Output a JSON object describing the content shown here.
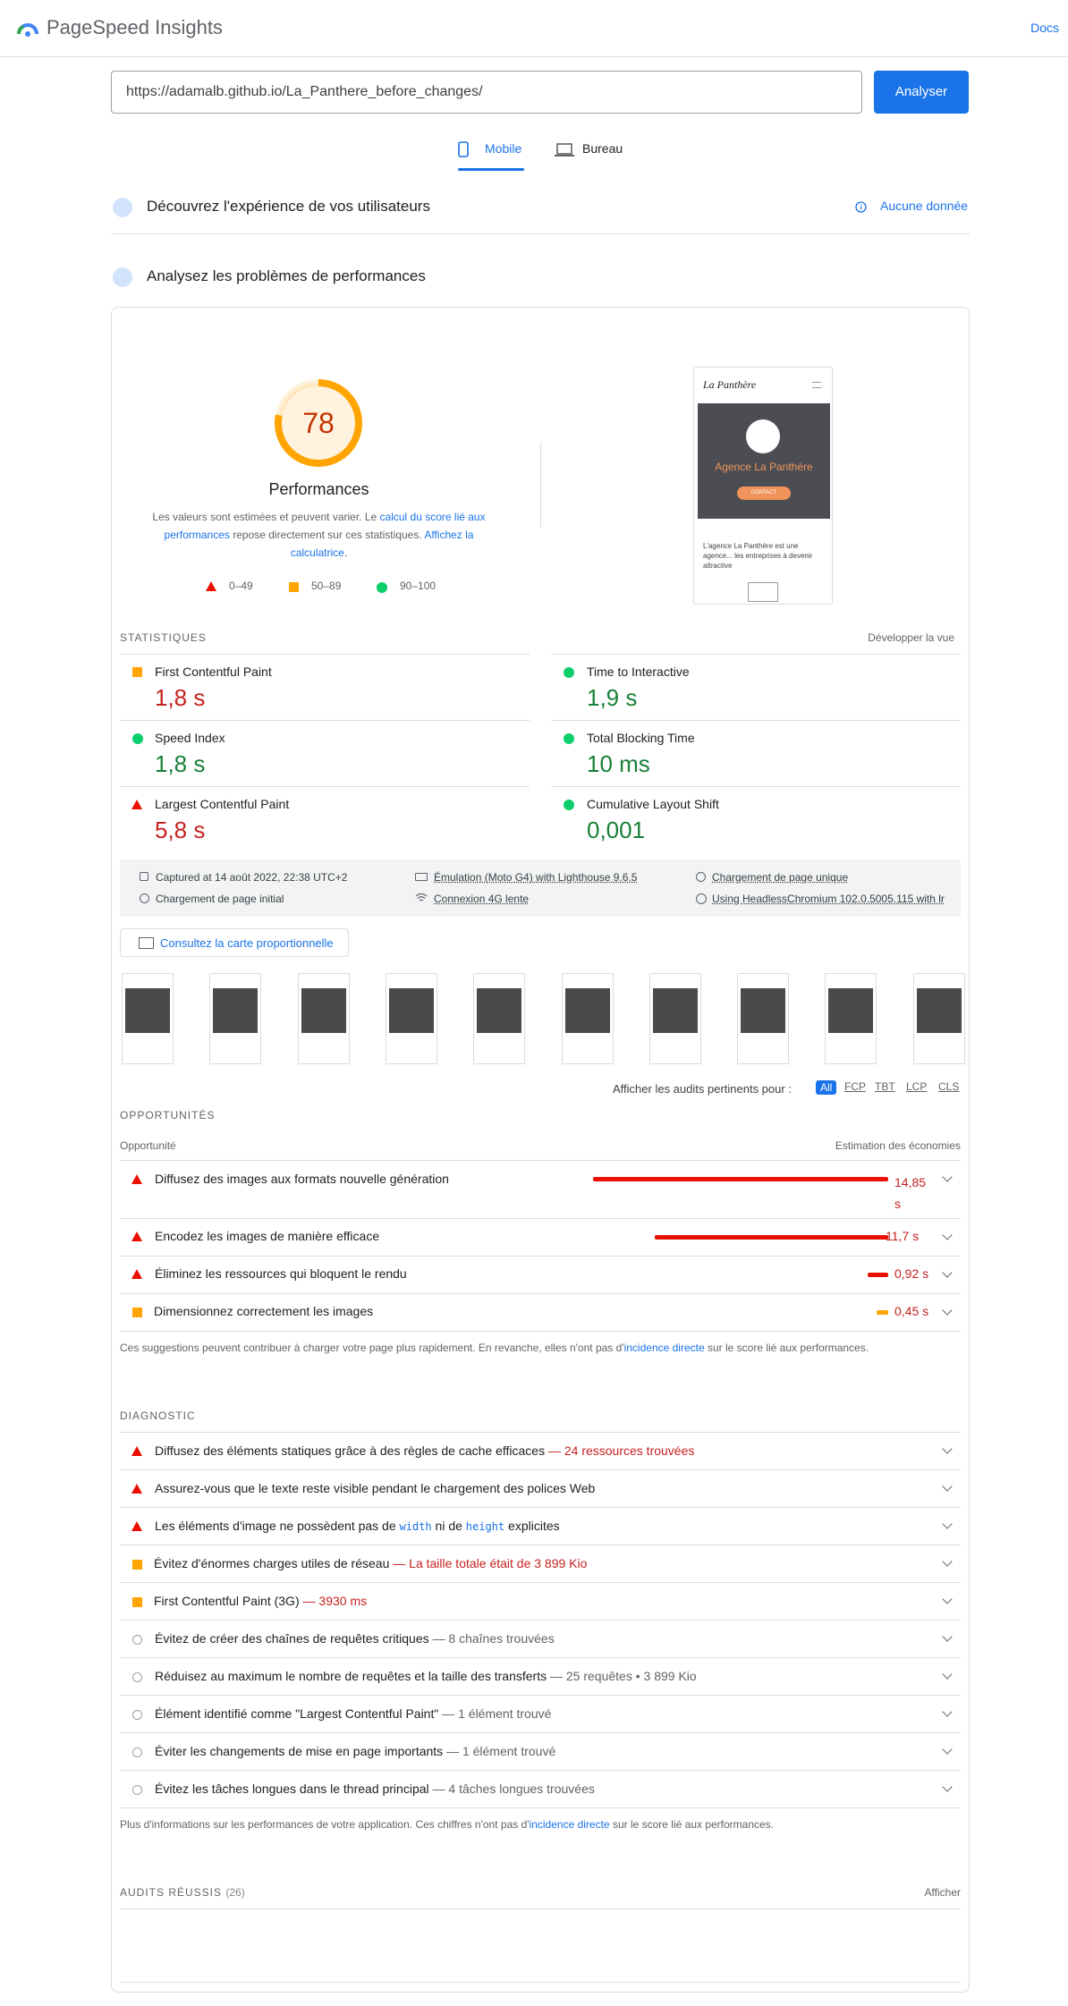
{
  "header": {
    "brand": "PageSpeed Insights",
    "docs": "Docs"
  },
  "search": {
    "url": "https://adamalb.github.io/La_Panthere_before_changes/",
    "analyze": "Analyser"
  },
  "tabs": {
    "mobile": "Mobile",
    "desktop": "Bureau"
  },
  "crux": {
    "title": "Découvrez l'expérience de vos utilisateurs",
    "no_data": "Aucune donnée"
  },
  "lab": {
    "title": "Analysez les problèmes de performances"
  },
  "score": {
    "value": "78",
    "fraction": 0.78,
    "label": "Performances",
    "note_prefix": "Les valeurs sont estimées et peuvent varier. Le ",
    "note_link1": "calcul du score lié aux performances",
    "note_mid": " repose directement sur ces statistiques. ",
    "note_link2": "Affichez la calculatrice",
    "note_end": ".",
    "legend": {
      "fail": "0–49",
      "average": "50–89",
      "pass": "90–100"
    }
  },
  "preview": {
    "brand": "La Panthère",
    "headline": "Agence La Panthère",
    "cta": "CONTACT",
    "text": "L'agence La Panthère est une agence... les entreprises à devenir attractive"
  },
  "metrics": {
    "header": "STATISTIQUES",
    "expand": "Développer la vue",
    "fcp": {
      "label": "First Contentful Paint",
      "value": "1,8 s"
    },
    "tti": {
      "label": "Time to Interactive",
      "value": "1,9 s"
    },
    "si": {
      "label": "Speed Index",
      "value": "1,8 s"
    },
    "tbt": {
      "label": "Total Blocking Time",
      "value": "10 ms"
    },
    "lcp": {
      "label": "Largest Contentful Paint",
      "value": "5,8 s"
    },
    "cls": {
      "label": "Cumulative Layout Shift",
      "value": "0,001"
    }
  },
  "runinfo": {
    "captured": "Captured at 14 août 2022, 22:38 UTC+2",
    "emulation": "Émulation (Moto G4) with Lighthouse 9.6.5",
    "single": "Chargement de page unique",
    "initial": "Chargement de page initial",
    "network": "Connexion 4G lente",
    "browser": "Using HeadlessChromium 102.0.5005.115 with lr"
  },
  "treemap": "Consultez la carte proportionnelle",
  "filter": {
    "label": "Afficher les audits pertinents pour :",
    "chips": [
      "All",
      "FCP",
      "TBT",
      "LCP",
      "CLS"
    ]
  },
  "opportunities": {
    "header": "OPPORTUNITÉS",
    "col1": "Opportunité",
    "col2": "Estimation des économies",
    "items": [
      {
        "title": "Diffusez des images aux formats nouvelle génération",
        "saving": "14,85 s",
        "fraction": 1.0
      },
      {
        "title": "Encodez les images de manière efficace",
        "saving": "11,7 s",
        "fraction": 0.79
      },
      {
        "title": "Éliminez les ressources qui bloquent le rendu",
        "saving": "0,92 s",
        "fraction": 0.07
      },
      {
        "title": "Dimensionnez correctement les images",
        "saving": "0,45 s",
        "fraction": 0.04
      }
    ],
    "note_prefix": "Ces suggestions peuvent contribuer à charger votre page plus rapidement. En revanche, elles n'ont pas d'",
    "note_link": "incidence directe",
    "note_suffix": " sur le score lié aux performances."
  },
  "diagnostics": {
    "header": "DIAGNOSTIC",
    "items": [
      {
        "title": "Diffusez des éléments statiques grâce à des règles de cache efficaces",
        "detail": "— 24 ressources trouvées"
      },
      {
        "title": "Assurez-vous que le texte reste visible pendant le chargement des polices Web",
        "detail": ""
      },
      {
        "title_a": "Les éléments d'image ne possèdent pas de ",
        "code1": "width",
        "title_b": " ni de ",
        "code2": "height",
        "title_c": " explicites"
      },
      {
        "title": "Évitez d'énormes charges utiles de réseau",
        "detail": "— La taille totale était de 3 899 Kio"
      },
      {
        "title": "First Contentful Paint (3G)",
        "detail": "— 3930 ms"
      },
      {
        "title": "Évitez de créer des chaînes de requêtes critiques",
        "detail": "— 8 chaînes trouvées"
      },
      {
        "title": "Réduisez au maximum le nombre de requêtes et la taille des transferts",
        "detail": "— 25 requêtes • 3 899 Kio"
      },
      {
        "title": "Élément identifié comme \"Largest Contentful Paint\"",
        "detail": "— 1 élément trouvé"
      },
      {
        "title": "Éviter les changements de mise en page importants",
        "detail": "— 1 élément trouvé"
      },
      {
        "title": "Évitez les tâches longues dans le thread principal",
        "detail": "— 4 tâches longues trouvées"
      }
    ],
    "note_prefix": "Plus d'informations sur les performances de votre application. Ces chiffres n'ont pas d'",
    "note_link": "incidence directe",
    "note_suffix": " sur le score lié aux performances."
  },
  "passed": {
    "header": "AUDITS RÉUSSIS",
    "count": "(26)",
    "show": "Afficher"
  },
  "colors": {
    "accent": "#1a73e8",
    "fail": "#eb0f00",
    "average": "#ffa400",
    "pass": "#0cce6b"
  }
}
